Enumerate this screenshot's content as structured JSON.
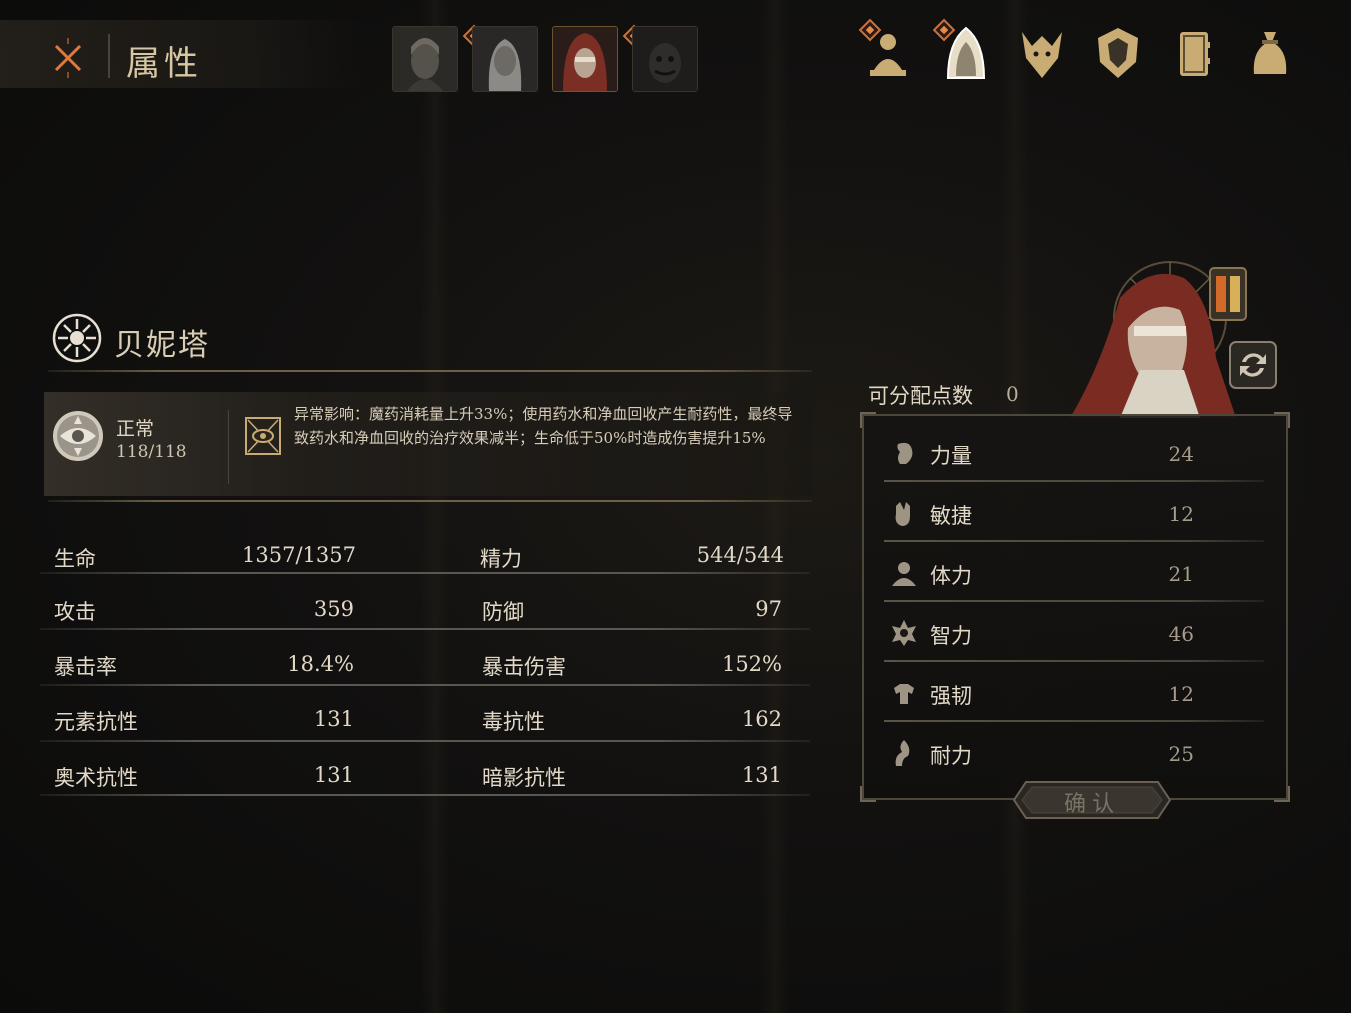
{
  "header": {
    "title": "属性",
    "portraits": [
      {
        "name": "warrior-portrait"
      },
      {
        "name": "white-hair-portrait"
      },
      {
        "name": "red-hood-portrait"
      },
      {
        "name": "masked-portrait"
      }
    ]
  },
  "nav_icons": [
    "character-icon",
    "hood-icon",
    "beast-icon",
    "shield-icon",
    "journal-icon",
    "pouch-icon"
  ],
  "character": {
    "name": "贝妮塔",
    "status_label": "正常",
    "status_value": "118/118",
    "effect_text": "异常影响：魔药消耗量上升33%；使用药水和净血回收产生耐药性，最终导致药水和净血回收的治疗效果减半；生命低于50%时造成伤害提升15%"
  },
  "stats": [
    {
      "name": "生命",
      "value": "1357/1357",
      "name2": "精力",
      "value2": "544/544"
    },
    {
      "name": "攻击",
      "value": "359",
      "name2": "防御",
      "value2": "97"
    },
    {
      "name": "暴击率",
      "value": "18.4%",
      "name2": "暴击伤害",
      "value2": "152%"
    },
    {
      "name": "元素抗性",
      "value": "131",
      "name2": "毒抗性",
      "value2": "162"
    },
    {
      "name": "奥术抗性",
      "value": "131",
      "name2": "暗影抗性",
      "value2": "131"
    }
  ],
  "attributes": {
    "points_label": "可分配点数",
    "points_value": "0",
    "items": [
      {
        "name": "力量",
        "value": "24",
        "icon": "strength-icon"
      },
      {
        "name": "敏捷",
        "value": "12",
        "icon": "agility-icon"
      },
      {
        "name": "体力",
        "value": "21",
        "icon": "vitality-icon"
      },
      {
        "name": "智力",
        "value": "46",
        "icon": "intellect-icon"
      },
      {
        "name": "强韧",
        "value": "12",
        "icon": "toughness-icon"
      },
      {
        "name": "耐力",
        "value": "25",
        "icon": "endurance-icon"
      }
    ],
    "confirm_label": "确认"
  },
  "colors": {
    "accent_orange": "#e07a3c",
    "gold": "#c9ab74",
    "text": "#e2d9c8"
  }
}
